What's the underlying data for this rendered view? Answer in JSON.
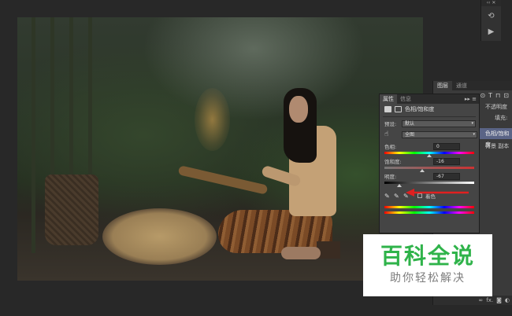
{
  "mini_dock": {
    "top_label": "‹‹ ✕",
    "icons": [
      "history-icon",
      "play-icon"
    ]
  },
  "layers_panel": {
    "tabs": [
      "图层",
      "通道"
    ],
    "opacity_label": "不透明度",
    "fill_label": "填充:",
    "layer_active": "色相/饱和度",
    "layer_bg": "背景 副本",
    "footer_icons": [
      "link-icon",
      "fx-icon",
      "mask-icon",
      "adjustment-icon"
    ],
    "footer_fx": "fx."
  },
  "properties_panel": {
    "tabs": [
      "属性",
      "信息"
    ],
    "tab_controls": "▸▸ ≡",
    "title": "色相/饱和度",
    "preset_label": "预设:",
    "preset_value": "默认",
    "channel_value": "全图",
    "hue_label": "色相:",
    "hue_value": "0",
    "saturation_label": "饱和度:",
    "saturation_value": "-16",
    "lightness_label": "明度:",
    "lightness_value": "-67",
    "colorize_label": "着色",
    "hue_level": 0.5,
    "saturation_level": 0.42,
    "lightness_level": 0.165
  },
  "watermark": {
    "title": "百科全说",
    "subtitle": "助你轻松解决"
  },
  "colors": {
    "workspace": "#282828",
    "panel": "#454545",
    "accent_arrow": "#e02020",
    "watermark_green": "#2fb34a",
    "layer_selected": "#5a6486"
  }
}
